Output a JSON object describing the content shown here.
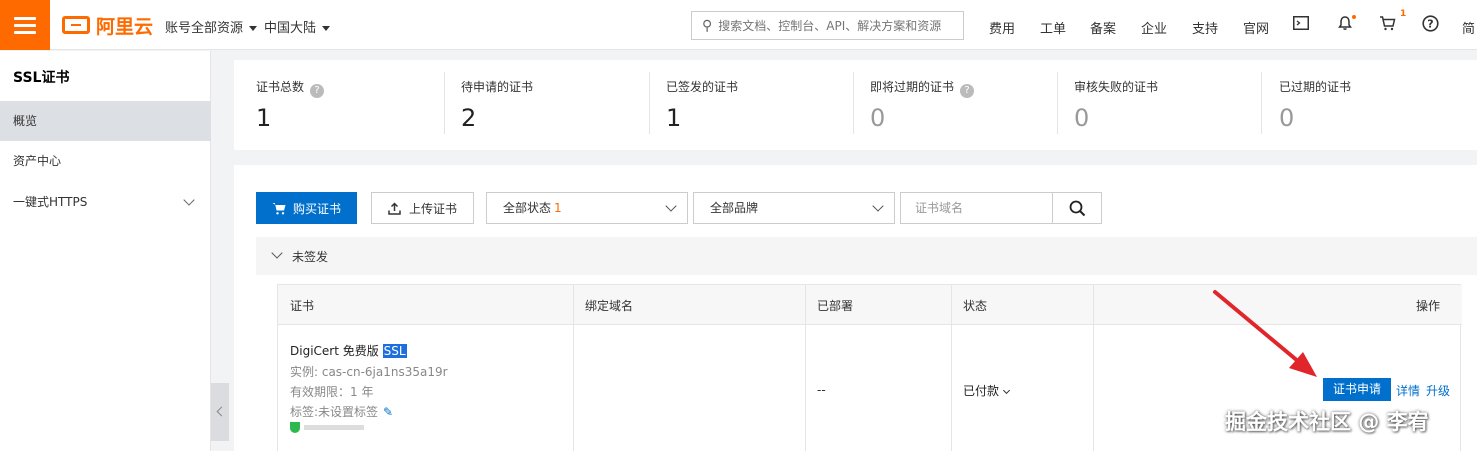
{
  "topbar": {
    "logo_text": "阿里云",
    "account_dropdown": "账号全部资源",
    "region_dropdown": "中国大陆",
    "search_placeholder": "搜索文档、控制台、API、解决方案和资源",
    "nav": [
      "费用",
      "工单",
      "备案",
      "企业",
      "支持",
      "官网"
    ],
    "cart_badge": "1",
    "lang": "简"
  },
  "sidebar": {
    "title": "SSL证书",
    "items": [
      {
        "label": "概览"
      },
      {
        "label": "资产中心"
      },
      {
        "label": "一键式HTTPS"
      }
    ]
  },
  "stats": [
    {
      "label": "证书总数",
      "value": "1"
    },
    {
      "label": "待申请的证书",
      "value": "2"
    },
    {
      "label": "已签发的证书",
      "value": "1"
    },
    {
      "label": "即将过期的证书",
      "value": "0"
    },
    {
      "label": "审核失败的证书",
      "value": "0"
    },
    {
      "label": "已过期的证书",
      "value": "0"
    }
  ],
  "toolbar": {
    "buy_label": "购买证书",
    "upload_label": "上传证书",
    "status_filter": "全部状态",
    "status_count": "1",
    "brand_filter": "全部品牌",
    "domain_placeholder": "证书域名"
  },
  "group": {
    "label": "未签发"
  },
  "table": {
    "headers": [
      "证书",
      "绑定域名",
      "已部署",
      "状态",
      "操作"
    ],
    "row": {
      "name": "DigiCert 免费版",
      "name_highlight": "SSL",
      "instance": "实例: cas-cn-6ja1ns35a19r",
      "validity": "有效期限：1 年",
      "tags": "标签:未设置标签",
      "deployed": "--",
      "status": "已付款",
      "apply_button": "证书申请",
      "details_link": "详情",
      "upgrade_link": "升级"
    }
  },
  "watermark": "掘金技术社区 @ 李宥",
  "colors": {
    "brand": "#ff6a00",
    "primary": "#0070cc",
    "arrow": "#e0262b"
  }
}
